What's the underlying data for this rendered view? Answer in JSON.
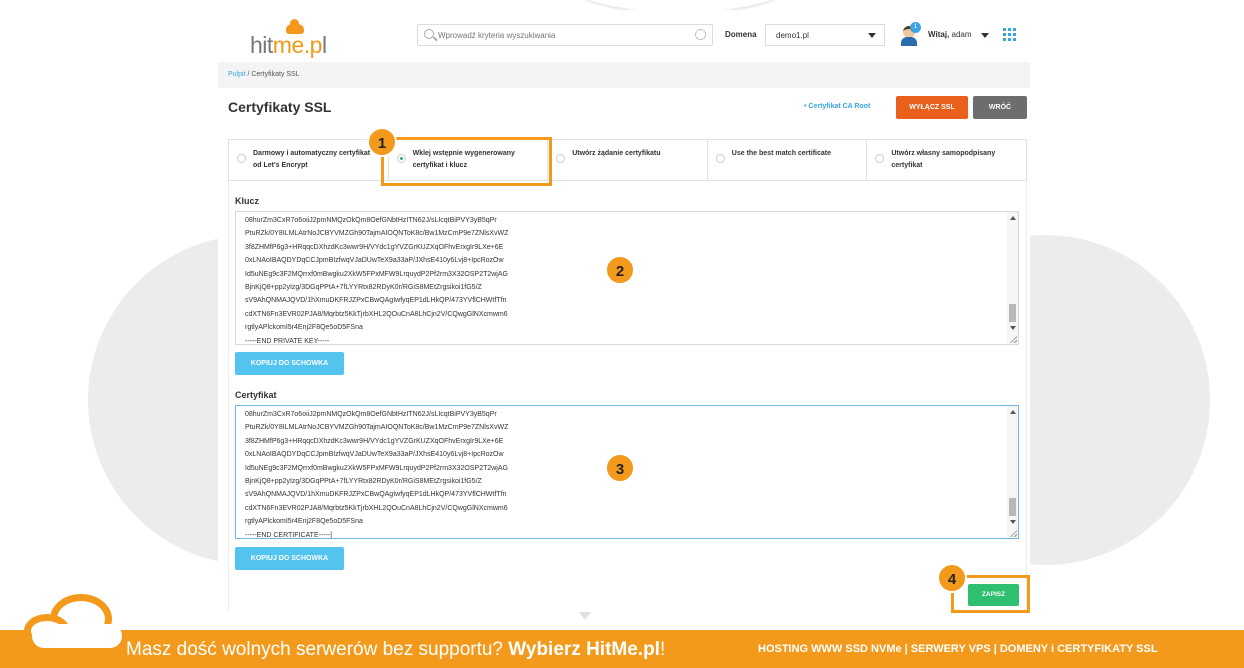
{
  "header": {
    "logo_text_a": "hit",
    "logo_text_b": "me.p",
    "logo_text_c": "l",
    "search_placeholder": "Wprowadź kryteria wyszukiwania",
    "domain_label": "Domena",
    "domain_value": "demo1.pl",
    "notification_count": "1",
    "greeting": "Witaj,",
    "username": "adam"
  },
  "breadcrumb": {
    "root": "Pulpit",
    "separator": " / ",
    "current": "Certyfikaty SSL"
  },
  "page": {
    "title": "Certyfikaty SSL",
    "ca_root_link": "• Certyfikat CA Root",
    "disable_ssl_button": "WYŁĄCZ SSL",
    "back_button": "WRÓĆ"
  },
  "options": [
    {
      "label": "Darmowy i automatyczny certyfikat od Let's Encrypt",
      "checked": false
    },
    {
      "label": "Wklej wstępnie wygenerowany certyfikat i klucz",
      "checked": true
    },
    {
      "label": "Utwórz żądanie certyfikatu",
      "checked": false
    },
    {
      "label": "Use the best match certificate",
      "checked": false
    },
    {
      "label": "Utwórz własny samopodpisany certyfikat",
      "checked": false
    }
  ],
  "key_section": {
    "label": "Klucz",
    "content": "08hurZm3CxR7o6oiiJ2pmNMQzOkQm8OefGNbtHzITN62J/sLIcqtBiPVY3yB5qPr\nPtuRZk/0Y8ILMLAtrNoJCBYVMZGh90TajmAIOQNToK8c/Bw1MzCmP9e7ZNlsXvWZ\n3f8ZHMfP6g3+HRqqcDXhzdKc3wwr9H/VYdc1gYVZGrKUZXqOFhvErxgIr9LXe+6E\n0xLNAoIBAQDYDqCCJpmBIzfwqVJaDUwTeX9a33aP/JXhsE410y6Lvj8+IpcRozOw\nId5uNEg9c3F2MQrrxf0mBwgku2XkW5FPxMFW9LrquydP2Pf2rm3X32OSP2T2wjAG\nBjnKjQ8+pp2yIzg/3DGqPPtA+7fLYYRtx82RDyK0r/RGiS8MEtZrgsikoi1fG5/Z\nsV9AhQNMAJQVD/1hXmuDKFRJZPxCBwQAgIwfyqEP1dLHkQP/473YVflCHWtfTfn\ncdXTN6Fn3EVR02PJA8/Mqrbtz5KkTjrbXHL2QOuCnA8LhCjn2V/CQwgGlNXcmwm6\nrgtlyAPlckomI5r4Enj2F8Qe5oD5FSna\n-----END PRIVATE KEY-----",
    "copy_button": "KOPIUJ DO SCHOWKA"
  },
  "cert_section": {
    "label": "Certyfikat",
    "content": "08hurZm3CxR7o6oiiJ2pmNMQzOkQm8OefGNbtHzITN62J/sLIcqtBiPVY3yB5qPr\nPtuRZk/0Y8ILMLAtrNoJCBYVMZGh90TajmAIOQNToK8c/Bw1MzCmP9e7ZNlsXvWZ\n3f8ZHMfP6g3+HRqqcDXhzdKc3wwr9H/VYdc1gYVZGrKUZXqOFhvErxgIr9LXe+6E\n0xLNAoIBAQDYDqCCJpmBIzfwqVJaDUwTeX9a33aP/JXhsE410y6Lvj8+IpcRozOw\nId5uNEg9c3F2MQrrxf0mBwgku2XkW5FPxMFW9LrquydP2Pf2rm3X32OSP2T2wjAG\nBjnKjQ8+pp2yIzg/3DGqPPtA+7fLYYRtx82RDyK0r/RGiS8MEtZrgsikoi1fG5/Z\nsV9AhQNMAJQVD/1hXmuDKFRJZPxCBwQAgIwfyqEP1dLHkQP/473YVflCHWtfTfn\ncdXTN6Fn3EVR02PJA8/Mqrbtz5KkTjrbXHL2QOuCnA8LhCjn2V/CQwgGlNXcmwm6\nrgtlyAPlckomI5r4Enj2F8Qe5oD5FSna\n-----END CERTIFICATE-----|",
    "copy_button": "KOPIUJ DO SCHOWKA"
  },
  "save_button": "ZAPISZ",
  "steps": [
    "1",
    "2",
    "3",
    "4"
  ],
  "banner": {
    "text_plain": "Masz dość wolnych serwerów bez supportu? ",
    "text_bold": "Wybierz HitMe.pl",
    "text_end": "!",
    "right_text": "HOSTING WWW SSD NVMe | SERWERY VPS | DOMENY i CERTYFIKATY SSL"
  },
  "colors": {
    "accent_orange": "#f39a1c",
    "disable_ssl_red": "#e8601c",
    "back_gray": "#6d6d6d",
    "copy_blue": "#53c4f0",
    "save_green": "#2fbf71",
    "link_blue": "#3aa3e3"
  }
}
